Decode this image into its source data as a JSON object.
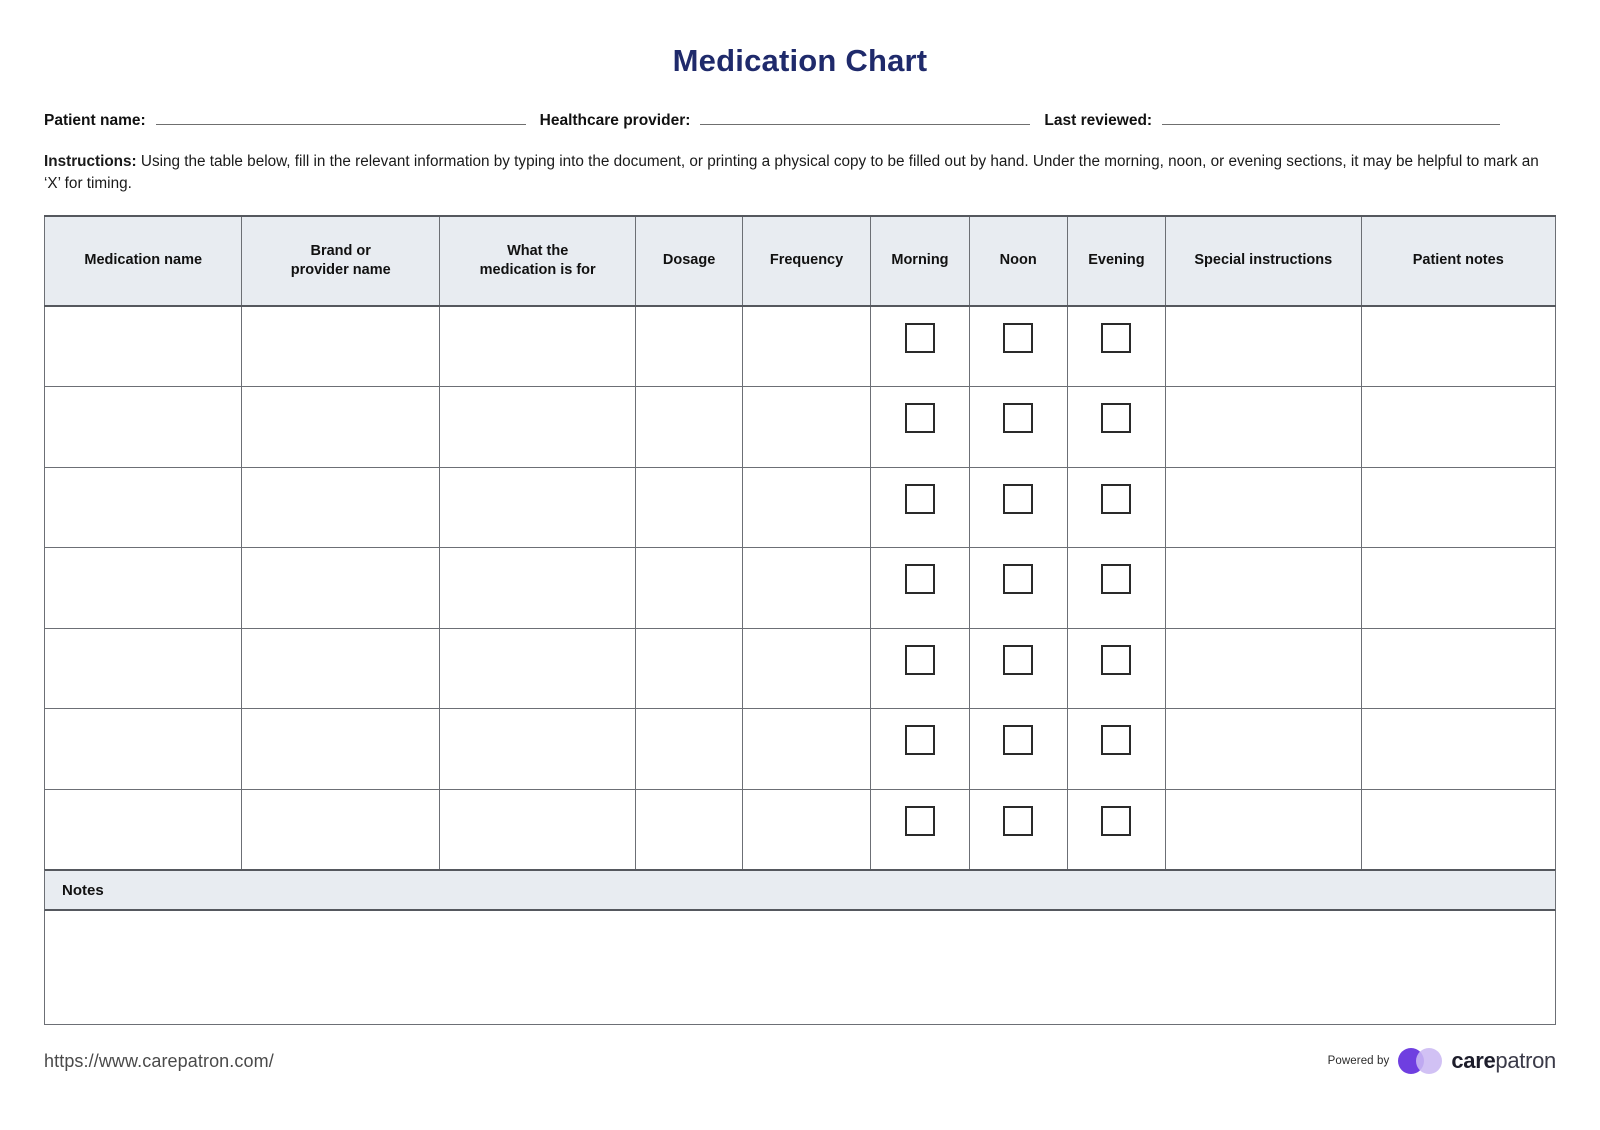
{
  "document": {
    "title": "Medication Chart"
  },
  "fields": [
    {
      "label": "Patient name:",
      "value": "",
      "name": "patient-name"
    },
    {
      "label": "Healthcare provider:",
      "value": "",
      "name": "healthcare-provider"
    },
    {
      "label": "Last reviewed:",
      "value": "",
      "name": "last-reviewed"
    }
  ],
  "instructions": {
    "label": "Instructions:",
    "text": " Using the table below, fill in the relevant information by typing into the document, or printing a physical copy to be filled out by hand. Under the morning, noon, or evening sections, it may be helpful to mark an ‘X’ for timing."
  },
  "table": {
    "columns": [
      "Medication name",
      "Brand or provider name",
      "What the medication is for",
      "Dosage",
      "Frequency",
      "Morning",
      "Noon",
      "Evening",
      "Special instructions",
      "Patient notes"
    ],
    "column_lines": [
      [
        "Medication name"
      ],
      [
        "Brand or",
        "provider name"
      ],
      [
        "What the",
        "medication is for"
      ],
      [
        "Dosage"
      ],
      [
        "Frequency"
      ],
      [
        "Morning"
      ],
      [
        "Noon"
      ],
      [
        "Evening"
      ],
      [
        "Special instructions"
      ],
      [
        "Patient notes"
      ]
    ],
    "row_count": 7,
    "rows": [
      {
        "medication_name": "",
        "brand_or_provider": "",
        "what_for": "",
        "dosage": "",
        "frequency": "",
        "morning": false,
        "noon": false,
        "evening": false,
        "special_instructions": "",
        "patient_notes": ""
      },
      {
        "medication_name": "",
        "brand_or_provider": "",
        "what_for": "",
        "dosage": "",
        "frequency": "",
        "morning": false,
        "noon": false,
        "evening": false,
        "special_instructions": "",
        "patient_notes": ""
      },
      {
        "medication_name": "",
        "brand_or_provider": "",
        "what_for": "",
        "dosage": "",
        "frequency": "",
        "morning": false,
        "noon": false,
        "evening": false,
        "special_instructions": "",
        "patient_notes": ""
      },
      {
        "medication_name": "",
        "brand_or_provider": "",
        "what_for": "",
        "dosage": "",
        "frequency": "",
        "morning": false,
        "noon": false,
        "evening": false,
        "special_instructions": "",
        "patient_notes": ""
      },
      {
        "medication_name": "",
        "brand_or_provider": "",
        "what_for": "",
        "dosage": "",
        "frequency": "",
        "morning": false,
        "noon": false,
        "evening": false,
        "special_instructions": "",
        "patient_notes": ""
      },
      {
        "medication_name": "",
        "brand_or_provider": "",
        "what_for": "",
        "dosage": "",
        "frequency": "",
        "morning": false,
        "noon": false,
        "evening": false,
        "special_instructions": "",
        "patient_notes": ""
      },
      {
        "medication_name": "",
        "brand_or_provider": "",
        "what_for": "",
        "dosage": "",
        "frequency": "",
        "morning": false,
        "noon": false,
        "evening": false,
        "special_instructions": "",
        "patient_notes": ""
      }
    ]
  },
  "notes": {
    "header": "Notes",
    "value": ""
  },
  "footer": {
    "url": "https://www.carepatron.com/",
    "powered_by": "Powered by",
    "brand_bold": "care",
    "brand_light": "patron"
  },
  "colors": {
    "title": "#1f2a6b",
    "header_bg": "#e8ecf1",
    "border": "#6c6f75",
    "brand_purple": "#6f3fe0",
    "brand_lavender": "#cbb8f2"
  }
}
